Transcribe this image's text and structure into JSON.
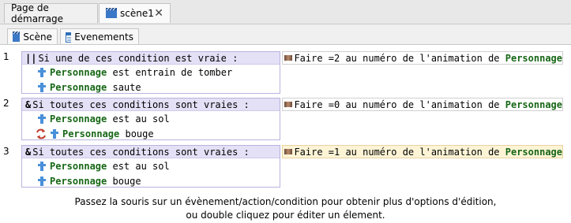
{
  "doc_tabs": [
    {
      "label": "Page de démarrage"
    },
    {
      "label": "scène1",
      "close": "✕"
    }
  ],
  "sub_tabs": [
    {
      "label": "Scène"
    },
    {
      "label": "Evenements"
    }
  ],
  "events": [
    {
      "number": "1",
      "head_symbol": "||",
      "head": "Si une de ces condition est vraie :",
      "conditions": [
        {
          "object": "Personnage",
          "text": " est entrain de tomber"
        },
        {
          "object": "Personnage",
          "text": " saute"
        }
      ],
      "action": {
        "prefix": "Faire =2 au numéro de l'animation de ",
        "object": "Personnage"
      }
    },
    {
      "number": "2",
      "head_symbol": "&",
      "head": "Si toutes ces conditions sont vraies :",
      "conditions": [
        {
          "object": "Personnage",
          "text": " est au sol"
        },
        {
          "object": "Personnage",
          "text": " bouge",
          "inverted": true
        }
      ],
      "action": {
        "prefix": "Faire =0 au numéro de l'animation de ",
        "object": "Personnage"
      }
    },
    {
      "number": "3",
      "head_symbol": "&",
      "head": "Si toutes ces conditions sont vraies :",
      "conditions": [
        {
          "object": "Personnage",
          "text": " est au sol"
        },
        {
          "object": "Personnage",
          "text": " bouge"
        }
      ],
      "action": {
        "prefix": "Faire =1 au numéro de l'animation de ",
        "object": "Personnage",
        "highlighted": true
      }
    }
  ],
  "footer": {
    "line1": "Passez la souris sur un évènement/action/condition pour obtenir plus d'options d'édition,",
    "line2": "ou double cliquez pour éditer un élement."
  },
  "colors": {
    "object_green": "#176717",
    "condition_head_bg": "#e4e0f6",
    "action_highlight": "#fdf4d6"
  }
}
